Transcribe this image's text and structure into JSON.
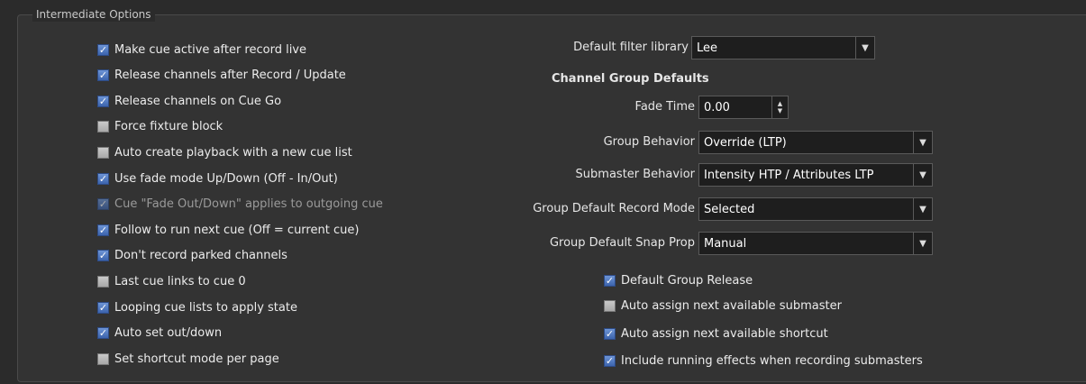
{
  "group": {
    "title": "Intermediate Options"
  },
  "left_options": [
    {
      "label": "Make cue active after record live",
      "checked": true,
      "disabled": false
    },
    {
      "label": "Release channels after Record / Update",
      "checked": true,
      "disabled": false
    },
    {
      "label": "Release channels on Cue Go",
      "checked": true,
      "disabled": false
    },
    {
      "label": "Force fixture block",
      "checked": false,
      "disabled": false
    },
    {
      "label": "Auto create playback with a new cue list",
      "checked": false,
      "disabled": false
    },
    {
      "label": "Use fade mode Up/Down (Off - In/Out)",
      "checked": true,
      "disabled": false
    },
    {
      "label": "Cue \"Fade Out/Down\" applies to outgoing cue",
      "checked": true,
      "disabled": true
    },
    {
      "label": "Follow to run next cue (Off = current cue)",
      "checked": true,
      "disabled": false
    },
    {
      "label": "Don't record parked channels",
      "checked": true,
      "disabled": false
    },
    {
      "label": "Last cue links to cue 0",
      "checked": false,
      "disabled": false
    },
    {
      "label": "Looping cue lists to apply state",
      "checked": true,
      "disabled": false
    },
    {
      "label": "Auto set out/down",
      "checked": true,
      "disabled": false
    },
    {
      "label": "Set shortcut mode per page",
      "checked": false,
      "disabled": false
    }
  ],
  "filter_library": {
    "label": "Default filter library",
    "value": "Lee"
  },
  "channel_group": {
    "title": "Channel Group Defaults",
    "fade_time": {
      "label": "Fade Time",
      "value": "0.00"
    },
    "group_behavior": {
      "label": "Group Behavior",
      "value": "Override (LTP)"
    },
    "submaster_behavior": {
      "label": "Submaster Behavior",
      "value": "Intensity HTP / Attributes LTP"
    },
    "record_mode": {
      "label": "Group Default Record Mode",
      "value": "Selected"
    },
    "snap_prop": {
      "label": "Group Default Snap Prop",
      "value": "Manual"
    }
  },
  "right_options": [
    {
      "label": "Default Group Release",
      "checked": true
    },
    {
      "label": "Auto assign next available submaster",
      "checked": false
    },
    {
      "label": "Auto assign next available shortcut",
      "checked": true
    },
    {
      "label": "Include running effects when recording submasters",
      "checked": true
    }
  ]
}
